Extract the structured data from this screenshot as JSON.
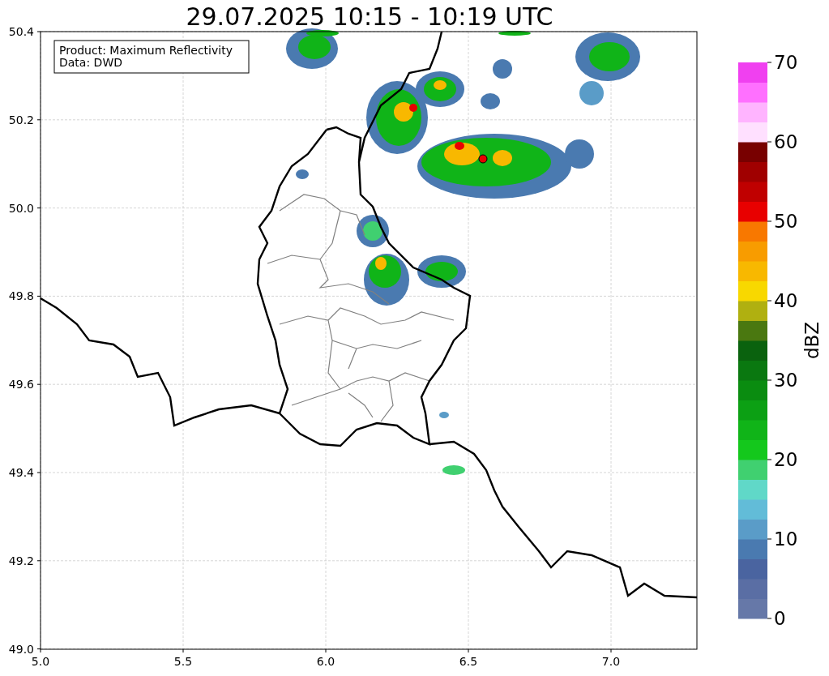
{
  "title": "29.07.2025 10:15 - 10:19 UTC",
  "legend": [
    "Product: Maximum Reflectivity",
    "Data: DWD"
  ],
  "x_ticks": [
    "5.0",
    "5.5",
    "6.0",
    "6.5",
    "7.0"
  ],
  "y_ticks": [
    "50.4",
    "50.2",
    "50.0",
    "49.8",
    "49.6",
    "49.4",
    "49.2",
    "49.0"
  ],
  "colorbar": {
    "label": "dBZ",
    "ticks": [
      "70",
      "60",
      "50",
      "40",
      "30",
      "20",
      "10",
      "0"
    ],
    "segments": [
      {
        "color": "#6678a8"
      },
      {
        "color": "#5a6ea4"
      },
      {
        "color": "#4a64a0"
      },
      {
        "color": "#4a7ab0"
      },
      {
        "color": "#5a9cc8"
      },
      {
        "color": "#62bcd8"
      },
      {
        "color": "#60d8c8"
      },
      {
        "color": "#40d070"
      },
      {
        "color": "#14c81c"
      },
      {
        "color": "#10b418"
      },
      {
        "color": "#0ca014"
      },
      {
        "color": "#0a8c10"
      },
      {
        "color": "#0a7810"
      },
      {
        "color": "#0a620e"
      },
      {
        "color": "#4a7810"
      },
      {
        "color": "#b0b010"
      },
      {
        "color": "#f8d800"
      },
      {
        "color": "#f8b800"
      },
      {
        "color": "#f89c00"
      },
      {
        "color": "#f87800"
      },
      {
        "color": "#e80000"
      },
      {
        "color": "#c00000"
      },
      {
        "color": "#a00000"
      },
      {
        "color": "#780000"
      },
      {
        "color": "#ffe0ff"
      },
      {
        "color": "#ffb4ff"
      },
      {
        "color": "#ff70ff"
      },
      {
        "color": "#f040f0"
      }
    ]
  }
}
